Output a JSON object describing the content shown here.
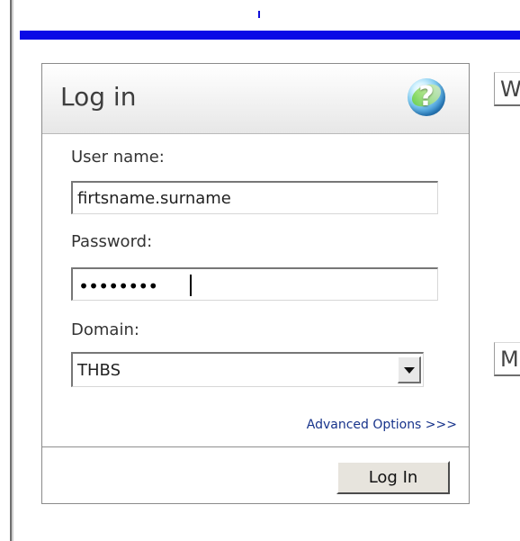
{
  "login_panel": {
    "title": "Log in",
    "username_label": "User name:",
    "username_value": "firtsname.surname",
    "password_label": "Password:",
    "password_value": "••••••••",
    "domain_label": "Domain:",
    "domain_selected": "THBS",
    "advanced_options_label": "Advanced Options >>>",
    "login_button_label": "Log In"
  },
  "side_tabs": {
    "top_label": "W",
    "bottom_label": "M"
  },
  "colors": {
    "blue_bar": "#0a0ae6",
    "link": "#17338b"
  },
  "icons": {
    "help": "help-icon",
    "dropdown_arrow": "dropdown-arrow-icon"
  }
}
